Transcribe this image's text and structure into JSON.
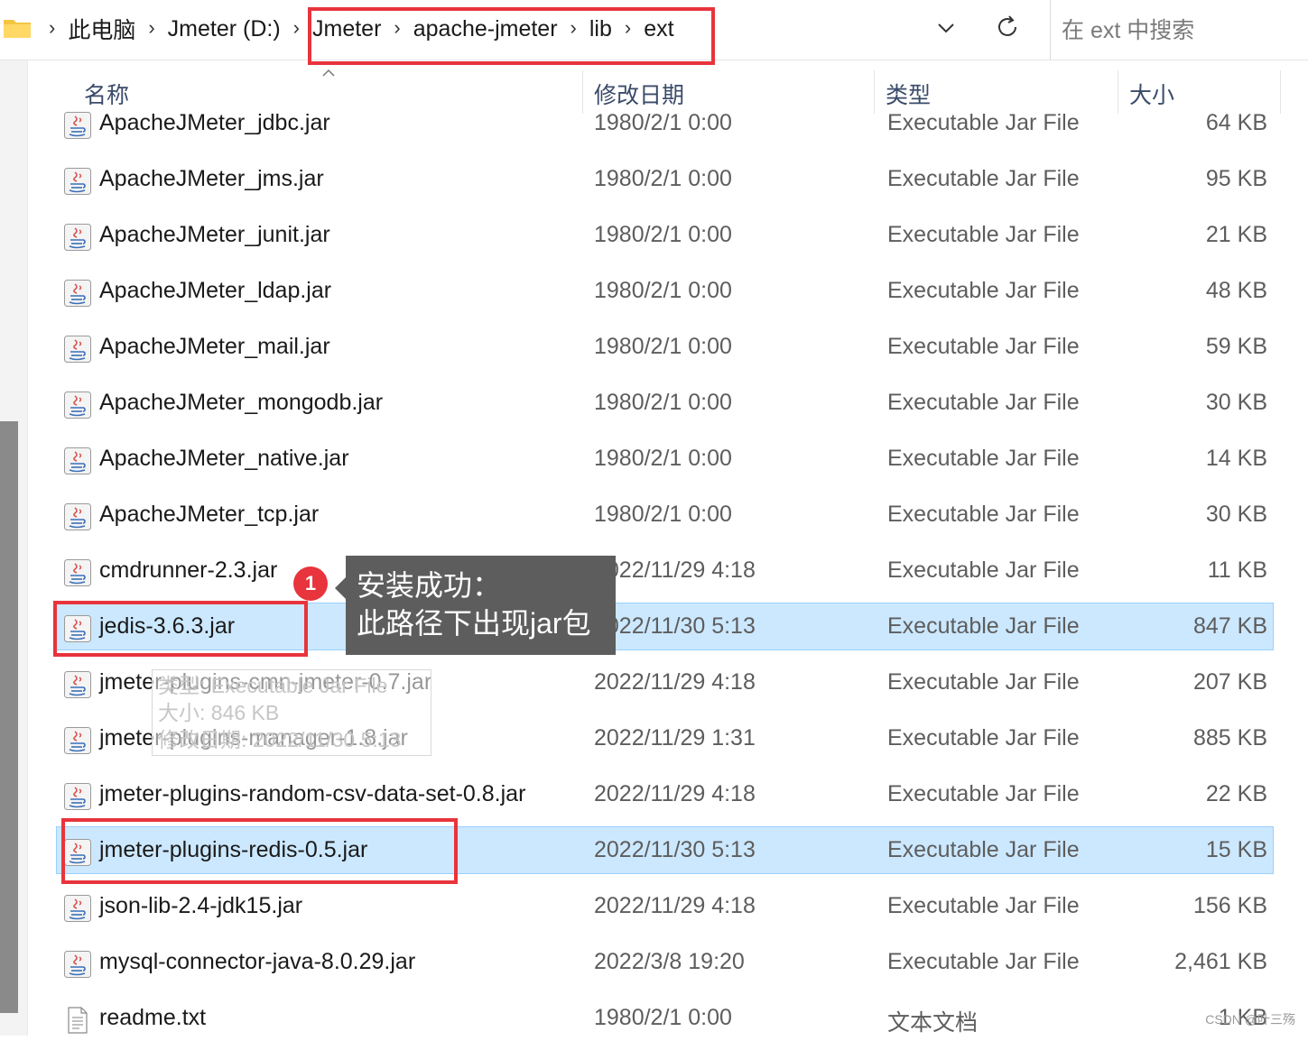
{
  "address_bar": {
    "crumbs": [
      "此电脑",
      "Jmeter (D:)",
      "Jmeter",
      "apache-jmeter",
      "lib",
      "ext"
    ],
    "search_placeholder": "在 ext 中搜索"
  },
  "columns": {
    "name": "名称",
    "date": "修改日期",
    "type": "类型",
    "size": "大小"
  },
  "files": [
    {
      "name": "ApacheJMeter_jdbc.jar",
      "date": "1980/2/1 0:00",
      "type": "Executable Jar File",
      "size": "64 KB",
      "icon": "jar-file-icon",
      "selected": false
    },
    {
      "name": "ApacheJMeter_jms.jar",
      "date": "1980/2/1 0:00",
      "type": "Executable Jar File",
      "size": "95 KB",
      "icon": "jar-file-icon",
      "selected": false
    },
    {
      "name": "ApacheJMeter_junit.jar",
      "date": "1980/2/1 0:00",
      "type": "Executable Jar File",
      "size": "21 KB",
      "icon": "jar-file-icon",
      "selected": false
    },
    {
      "name": "ApacheJMeter_ldap.jar",
      "date": "1980/2/1 0:00",
      "type": "Executable Jar File",
      "size": "48 KB",
      "icon": "jar-file-icon",
      "selected": false
    },
    {
      "name": "ApacheJMeter_mail.jar",
      "date": "1980/2/1 0:00",
      "type": "Executable Jar File",
      "size": "59 KB",
      "icon": "jar-file-icon",
      "selected": false
    },
    {
      "name": "ApacheJMeter_mongodb.jar",
      "date": "1980/2/1 0:00",
      "type": "Executable Jar File",
      "size": "30 KB",
      "icon": "jar-file-icon",
      "selected": false
    },
    {
      "name": "ApacheJMeter_native.jar",
      "date": "1980/2/1 0:00",
      "type": "Executable Jar File",
      "size": "14 KB",
      "icon": "jar-file-icon",
      "selected": false
    },
    {
      "name": "ApacheJMeter_tcp.jar",
      "date": "1980/2/1 0:00",
      "type": "Executable Jar File",
      "size": "30 KB",
      "icon": "jar-file-icon",
      "selected": false
    },
    {
      "name": "cmdrunner-2.3.jar",
      "date": "2022/11/29 4:18",
      "type": "Executable Jar File",
      "size": "11 KB",
      "icon": "jar-file-icon",
      "selected": false
    },
    {
      "name": "jedis-3.6.3.jar",
      "date": "2022/11/30 5:13",
      "type": "Executable Jar File",
      "size": "847 KB",
      "icon": "jar-file-icon",
      "selected": true
    },
    {
      "name": "jmeter-plugins-cmn-jmeter-0.7.jar",
      "date": "2022/11/29 4:18",
      "type": "Executable Jar File",
      "size": "207 KB",
      "icon": "jar-file-icon",
      "selected": false
    },
    {
      "name": "jmeter-plugins-manager-1.8.jar",
      "date": "2022/11/29 1:31",
      "type": "Executable Jar File",
      "size": "885 KB",
      "icon": "jar-file-icon",
      "selected": false
    },
    {
      "name": "jmeter-plugins-random-csv-data-set-0.8.jar",
      "date": "2022/11/29 4:18",
      "type": "Executable Jar File",
      "size": "22 KB",
      "icon": "jar-file-icon",
      "selected": false
    },
    {
      "name": "jmeter-plugins-redis-0.5.jar",
      "date": "2022/11/30 5:13",
      "type": "Executable Jar File",
      "size": "15 KB",
      "icon": "jar-file-icon",
      "selected": true
    },
    {
      "name": "json-lib-2.4-jdk15.jar",
      "date": "2022/11/29 4:18",
      "type": "Executable Jar File",
      "size": "156 KB",
      "icon": "jar-file-icon",
      "selected": false
    },
    {
      "name": "mysql-connector-java-8.0.29.jar",
      "date": "2022/3/8 19:20",
      "type": "Executable Jar File",
      "size": "2,461 KB",
      "icon": "jar-file-icon",
      "selected": false
    },
    {
      "name": "readme.txt",
      "date": "1980/2/1 0:00",
      "type": "文本文档",
      "size": "1 KB",
      "icon": "text-file-icon",
      "selected": false
    }
  ],
  "tooltip": {
    "lines": [
      "类型: Executable Jar File",
      "大小: 846 KB",
      "修改日期: 2022/11/30 5:13"
    ]
  },
  "annotation": {
    "badge": "1",
    "line1": "安装成功：",
    "line2": "此路径下出现jar包"
  },
  "watermark": "CSDN @叶三殇",
  "colors": {
    "highlight": "#cce8ff",
    "annotation_red": "#e8343c",
    "callout_bg": "#5d5d5d"
  }
}
